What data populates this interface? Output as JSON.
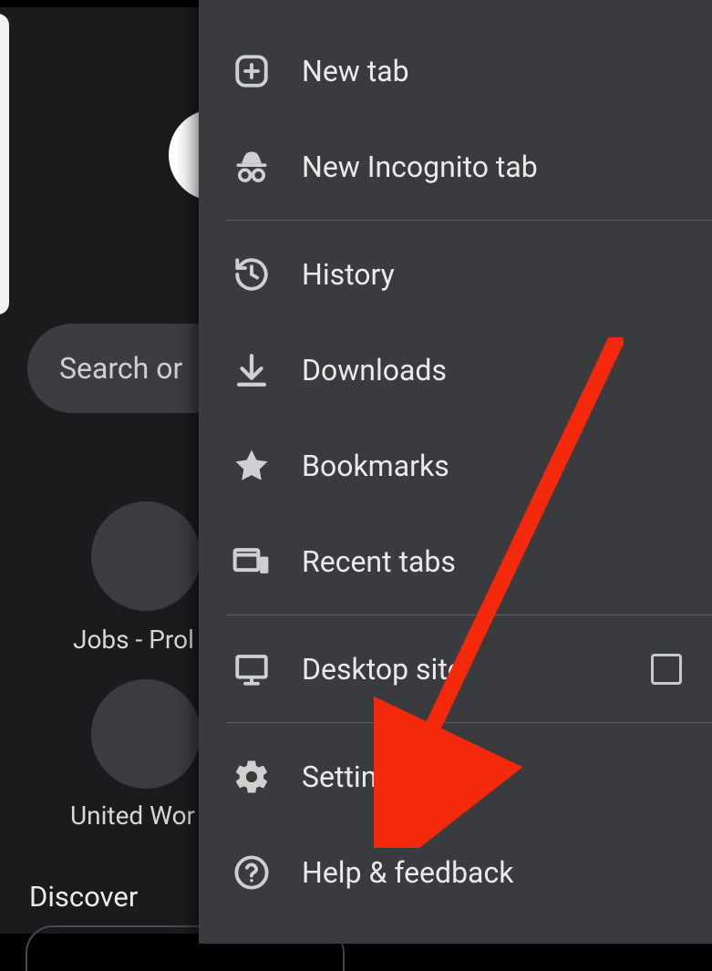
{
  "background": {
    "search_placeholder": "Search or",
    "tile_labels": [
      "Jobs - Prol",
      "United Wor"
    ],
    "discover_heading": "Discover"
  },
  "menu": {
    "items": [
      {
        "id": "new-tab",
        "label": "New tab",
        "icon": "plus-square-icon"
      },
      {
        "id": "incognito",
        "label": "New Incognito tab",
        "icon": "incognito-icon"
      },
      {
        "id": "divider"
      },
      {
        "id": "history",
        "label": "History",
        "icon": "history-icon"
      },
      {
        "id": "downloads",
        "label": "Downloads",
        "icon": "download-icon"
      },
      {
        "id": "bookmarks",
        "label": "Bookmarks",
        "icon": "star-icon"
      },
      {
        "id": "recent-tabs",
        "label": "Recent tabs",
        "icon": "devices-icon"
      },
      {
        "id": "divider"
      },
      {
        "id": "desktop-site",
        "label": "Desktop site",
        "icon": "desktop-icon",
        "checkbox": true
      },
      {
        "id": "divider"
      },
      {
        "id": "settings",
        "label": "Settings",
        "icon": "gear-icon"
      },
      {
        "id": "help",
        "label": "Help & feedback",
        "icon": "help-icon"
      }
    ]
  },
  "annotation": {
    "arrow_color": "#f4280a",
    "arrow_target": "settings"
  }
}
